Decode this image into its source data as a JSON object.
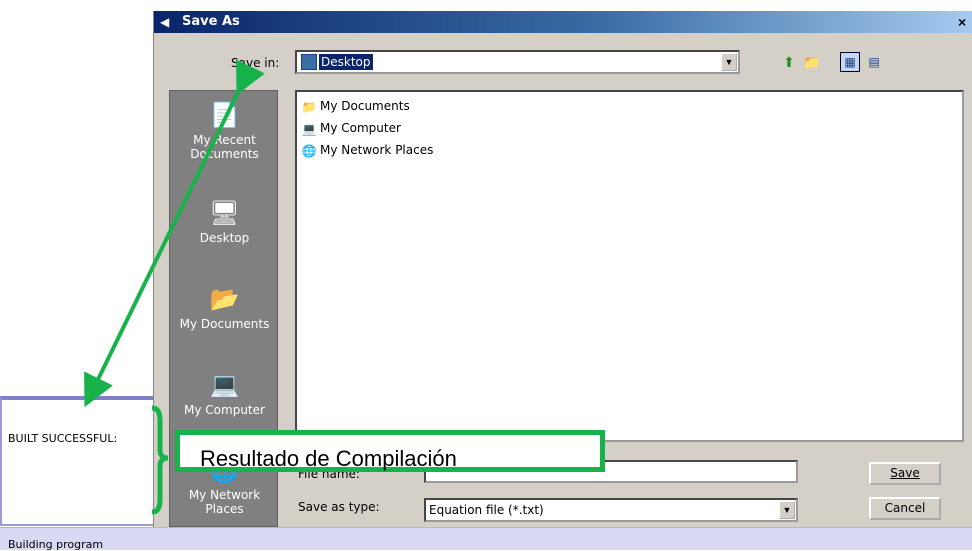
{
  "background": {
    "panel_text": "BUILT SUCCESSFUL:",
    "status_text": "Building program"
  },
  "dialog": {
    "title": "Save As",
    "close": "×",
    "save_in_label": "Save in:",
    "save_in_value": "Desktop",
    "places": [
      {
        "label_line1": "My Recent",
        "label_line2": "Documents",
        "icon": "recent-documents-icon"
      },
      {
        "label_line1": "Desktop",
        "label_line2": "",
        "icon": "desktop-icon"
      },
      {
        "label_line1": "My Documents",
        "label_line2": "",
        "icon": "my-documents-icon"
      },
      {
        "label_line1": "My Computer",
        "label_line2": "",
        "icon": "my-computer-icon"
      },
      {
        "label_line1": "My Network",
        "label_line2": "Places",
        "icon": "network-places-icon"
      }
    ],
    "files": [
      {
        "name": "My Documents",
        "icon": "folder-icon"
      },
      {
        "name": "My Computer",
        "icon": "computer-icon"
      },
      {
        "name": "My Network Places",
        "icon": "network-icon"
      }
    ],
    "file_name_label": "File name:",
    "file_name_value": "",
    "save_as_type_label": "Save as type:",
    "save_as_type_value": "Equation file (*.txt)",
    "save_button": "Save",
    "cancel_button": "Cancel"
  },
  "annotation": {
    "text": "Resultado de Compilación",
    "color": "#18b24a"
  }
}
